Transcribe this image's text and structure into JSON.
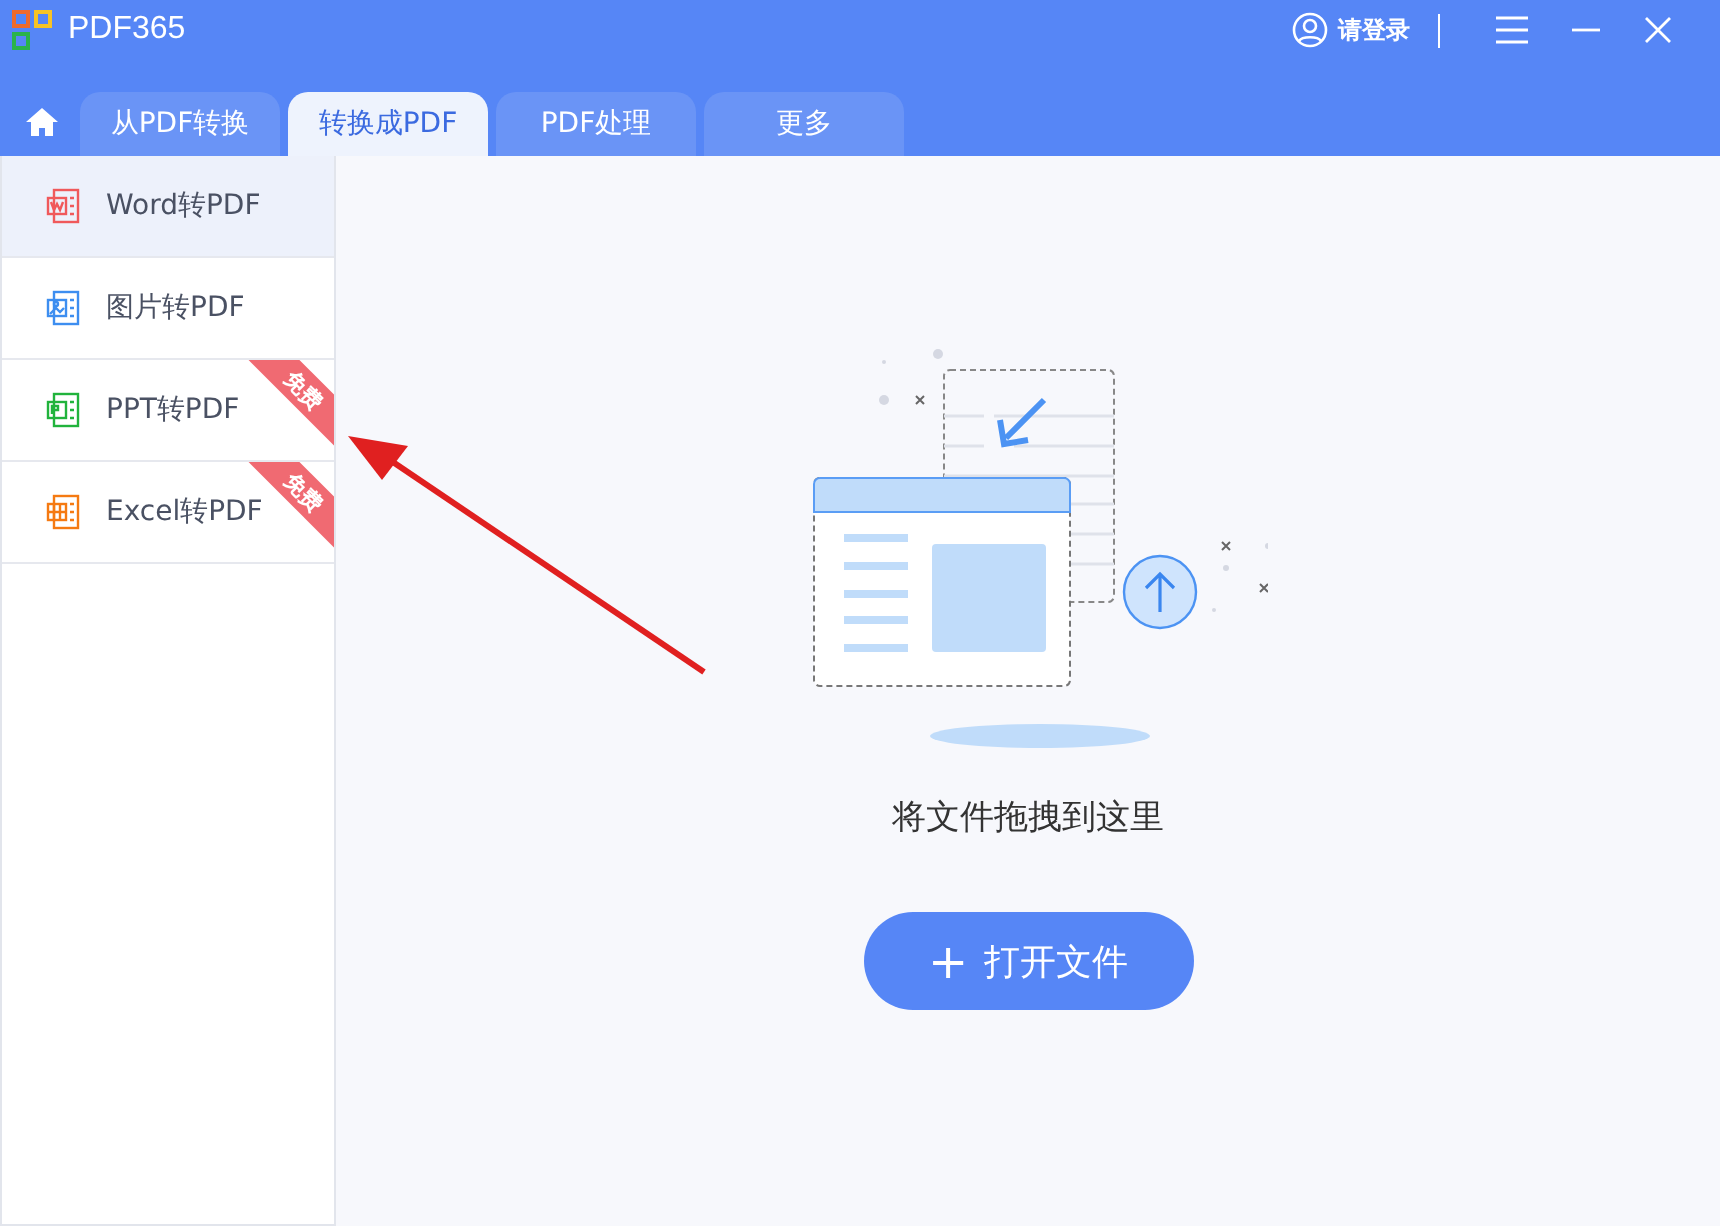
{
  "app": {
    "title": "PDF365"
  },
  "header": {
    "login": "请登录"
  },
  "tabs": [
    {
      "label": "从PDF转换",
      "selected": false
    },
    {
      "label": "转换成PDF",
      "selected": true
    },
    {
      "label": "PDF处理",
      "selected": false
    },
    {
      "label": "更多",
      "selected": false
    }
  ],
  "sidebar": {
    "items": [
      {
        "kind": "word",
        "label": "Word转PDF",
        "selected": true
      },
      {
        "kind": "image",
        "label": "图片转PDF",
        "selected": false
      },
      {
        "kind": "ppt",
        "label": "PPT转PDF",
        "selected": false,
        "badge": "免费"
      },
      {
        "kind": "excel",
        "label": "Excel转PDF",
        "selected": false,
        "badge": "免费"
      }
    ]
  },
  "dropzone": {
    "hint": "将文件拖拽到这里",
    "button": {
      "icon": "+",
      "label": "打开文件"
    }
  }
}
